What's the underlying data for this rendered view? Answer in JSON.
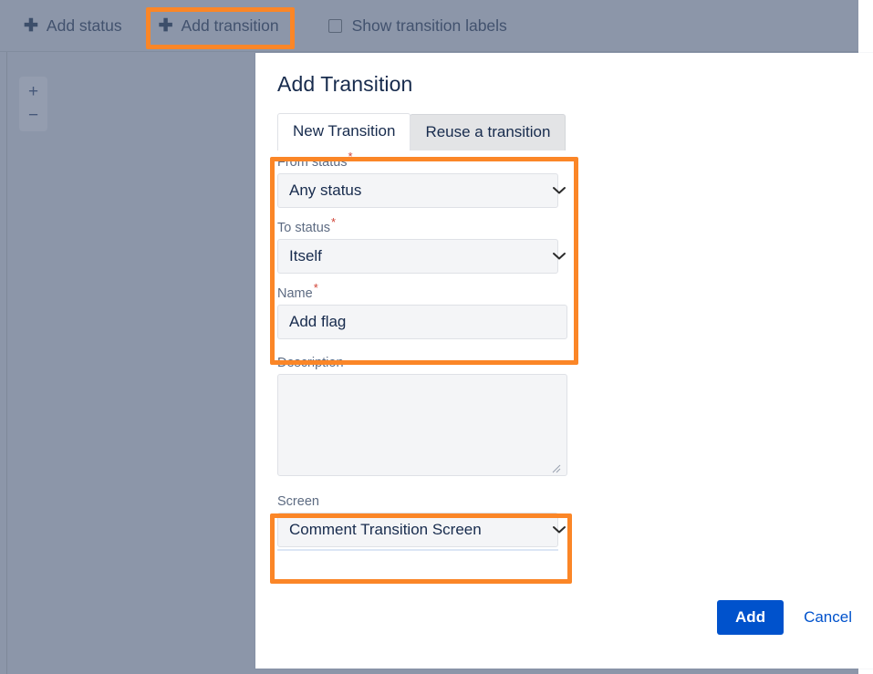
{
  "toolbar": {
    "add_status_label": "Add status",
    "add_transition_label": "Add transition",
    "show_labels_checkbox_label": "Show transition labels",
    "plus_glyph": "✚"
  },
  "canvas": {
    "zoom_in_label": "+",
    "zoom_out_label": "−"
  },
  "dialog": {
    "title": "Add Transition",
    "tabs": [
      {
        "label": "New Transition",
        "active": true
      },
      {
        "label": "Reuse a transition",
        "active": false
      }
    ],
    "fields": {
      "from_status": {
        "label": "From status",
        "required_marker": "*",
        "value": "Any status"
      },
      "to_status": {
        "label": "To status",
        "required_marker": "*",
        "value": "Itself"
      },
      "name": {
        "label": "Name",
        "required_marker": "*",
        "value": "Add flag",
        "placeholder": ""
      },
      "description": {
        "label": "Description",
        "value": "",
        "placeholder": ""
      },
      "screen": {
        "label": "Screen",
        "value": "Comment Transition Screen"
      }
    },
    "footer": {
      "add_label": "Add",
      "cancel_label": "Cancel"
    }
  },
  "colors": {
    "canvas_background": "#8c96a9",
    "highlight_orange": "#fb8627",
    "primary_blue": "#0052cc",
    "required_red": "#d04437",
    "field_background": "#f4f5f7",
    "text_dark": "#172b4d",
    "label_gray": "#5d6b82"
  }
}
